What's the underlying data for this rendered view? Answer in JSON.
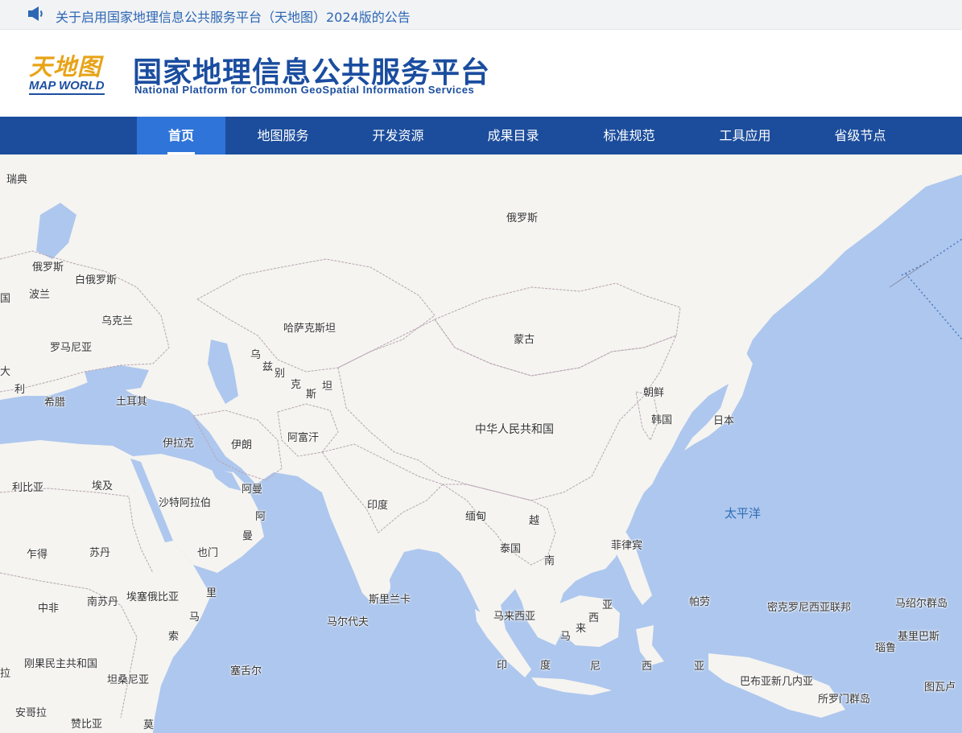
{
  "notice": {
    "icon": "speaker-icon",
    "text": "关于启用国家地理信息公共服务平台（天地图）2024版的公告"
  },
  "header": {
    "logo_cn": "天地图",
    "logo_en": "MAP WORLD",
    "title": "国家地理信息公共服务平台",
    "subtitle": "National Platform for Common GeoSpatial Information Services"
  },
  "nav": {
    "items": [
      {
        "label": "首页",
        "active": true
      },
      {
        "label": "地图服务"
      },
      {
        "label": "开发资源"
      },
      {
        "label": "成果目录"
      },
      {
        "label": "标准规范"
      },
      {
        "label": "工具应用"
      },
      {
        "label": "省级节点"
      }
    ]
  },
  "map": {
    "colors": {
      "land": "#f5f4f0",
      "water": "#aec7ee",
      "border": "#b8a4b4",
      "accent": "#1c4d9c"
    },
    "labels": [
      {
        "name": "俄罗斯"
      },
      {
        "name": "瑞典"
      },
      {
        "name": "俄罗斯"
      },
      {
        "name": "白俄罗斯"
      },
      {
        "name": "波兰"
      },
      {
        "name": "乌克兰"
      },
      {
        "name": "罗马尼亚"
      },
      {
        "name": "哈萨克斯坦"
      },
      {
        "name": "蒙古"
      },
      {
        "name": "乌"
      },
      {
        "name": "兹"
      },
      {
        "name": "别"
      },
      {
        "name": "克"
      },
      {
        "name": "斯"
      },
      {
        "name": "坦"
      },
      {
        "name": "朝鲜"
      },
      {
        "name": "韩国"
      },
      {
        "name": "日本"
      },
      {
        "name": "希腊"
      },
      {
        "name": "土耳其"
      },
      {
        "name": "利"
      },
      {
        "name": "大"
      },
      {
        "name": "中华人民共和国"
      },
      {
        "name": "伊拉克"
      },
      {
        "name": "伊朗"
      },
      {
        "name": "阿富汗"
      },
      {
        "name": "利比亚"
      },
      {
        "name": "埃及"
      },
      {
        "name": "沙特阿拉伯"
      },
      {
        "name": "阿曼"
      },
      {
        "name": "阿"
      },
      {
        "name": "曼"
      },
      {
        "name": "印度"
      },
      {
        "name": "缅甸"
      },
      {
        "name": "越"
      },
      {
        "name": "南"
      },
      {
        "name": "泰国"
      },
      {
        "name": "太平洋"
      },
      {
        "name": "菲律宾"
      },
      {
        "name": "乍得"
      },
      {
        "name": "苏丹"
      },
      {
        "name": "也门"
      },
      {
        "name": "中非"
      },
      {
        "name": "南苏丹"
      },
      {
        "name": "埃塞俄比亚"
      },
      {
        "name": "里"
      },
      {
        "name": "马"
      },
      {
        "name": "索"
      },
      {
        "name": "斯里兰卡"
      },
      {
        "name": "马尔代夫"
      },
      {
        "name": "马来西亚"
      },
      {
        "name": "亚"
      },
      {
        "name": "西"
      },
      {
        "name": "来"
      },
      {
        "name": "马"
      },
      {
        "name": "帕劳"
      },
      {
        "name": "密克罗尼西亚联邦"
      },
      {
        "name": "马绍尔群岛"
      },
      {
        "name": "基里巴斯"
      },
      {
        "name": "瑙鲁"
      },
      {
        "name": "印"
      },
      {
        "name": "度"
      },
      {
        "name": "尼"
      },
      {
        "name": "西"
      },
      {
        "name": "亚"
      },
      {
        "name": "刚果民主共和国"
      },
      {
        "name": "坦桑尼亚"
      },
      {
        "name": "塞舌尔"
      },
      {
        "name": "巴布亚新几内亚"
      },
      {
        "name": "所罗门群岛"
      },
      {
        "name": "图瓦卢"
      },
      {
        "name": "安哥拉"
      },
      {
        "name": "赞比亚"
      },
      {
        "name": "莫"
      },
      {
        "name": "拉"
      },
      {
        "name": "国"
      }
    ]
  }
}
